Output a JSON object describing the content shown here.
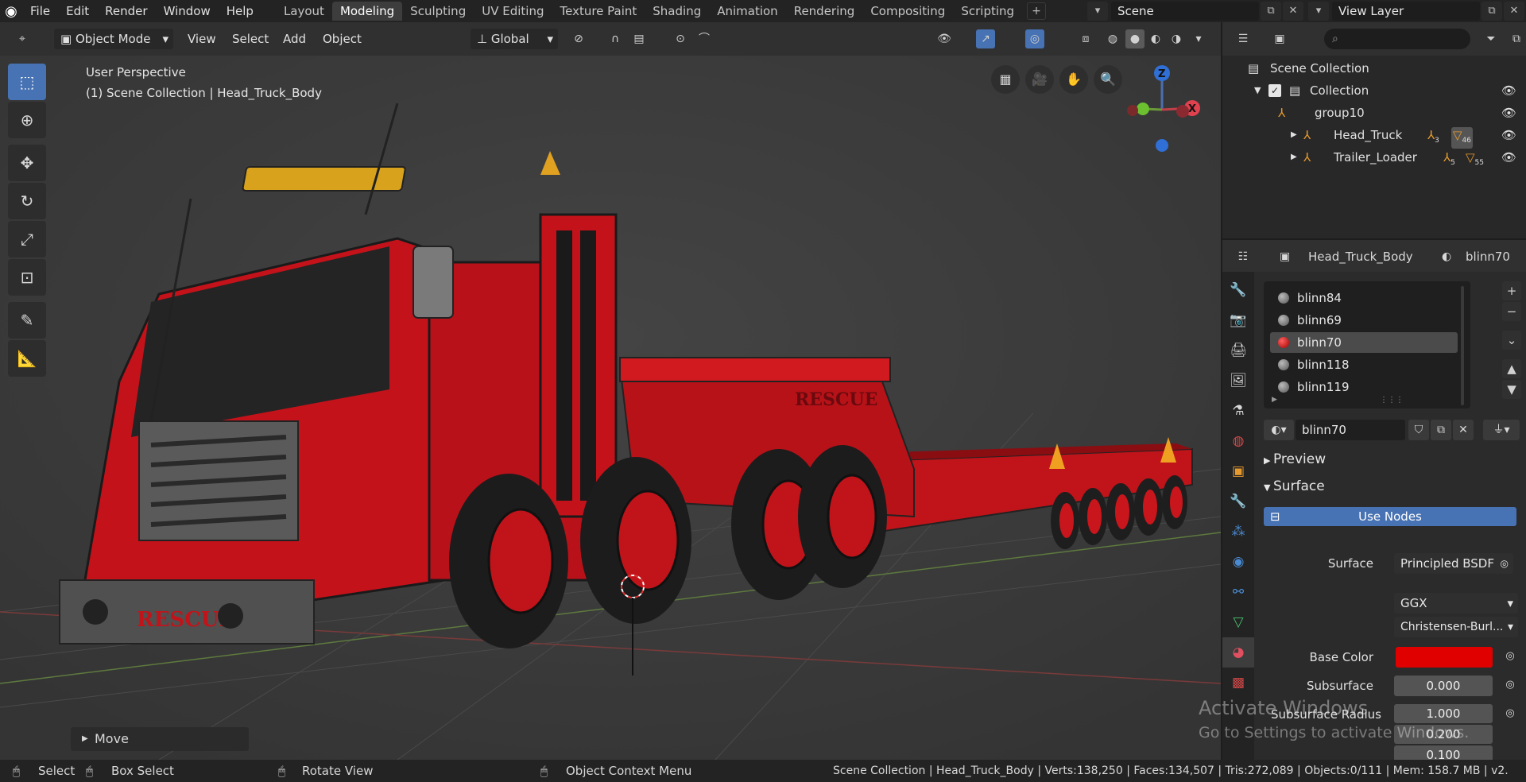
{
  "menu": [
    "File",
    "Edit",
    "Render",
    "Window",
    "Help"
  ],
  "workspaces": [
    "Layout",
    "Modeling",
    "Sculpting",
    "UV Editing",
    "Texture Paint",
    "Shading",
    "Animation",
    "Rendering",
    "Compositing",
    "Scripting"
  ],
  "active_workspace": "Modeling",
  "scene_name": "Scene",
  "view_layer": "View Layer",
  "viewport_header": {
    "mode": "Object Mode",
    "menus": [
      "View",
      "Select",
      "Add",
      "Object"
    ],
    "orientation": "Global"
  },
  "viewport": {
    "perspective_label": "User Perspective",
    "context_label": "(1) Scene Collection | Head_Truck_Body",
    "gizmo_axes": [
      "Z",
      "X"
    ],
    "operator_panel": "Move",
    "vehicle_text_front": "RESCUE",
    "vehicle_text_side": "RESCUE"
  },
  "outliner": {
    "rows": [
      {
        "label": "Scene Collection"
      },
      {
        "label": "Collection"
      },
      {
        "label": "group10"
      },
      {
        "label": "Head_Truck",
        "badge_a": "3",
        "badge_b": "46"
      },
      {
        "label": "Trailer_Loader",
        "badge_a": "5",
        "badge_b": "55"
      }
    ]
  },
  "properties": {
    "object_name": "Head_Truck_Body",
    "material_name": "blinn70",
    "slots": [
      "blinn84",
      "blinn69",
      "blinn70",
      "blinn118",
      "blinn119"
    ],
    "active_slot": "blinn70",
    "material_field": "blinn70",
    "panels": {
      "preview": "Preview",
      "surface": "Surface"
    },
    "use_nodes": "Use Nodes",
    "surface_label": "Surface",
    "surface_value": "Principled BSDF",
    "distribution": "GGX",
    "subsurface_method": "Christensen-Burl...",
    "base_color_label": "Base Color",
    "base_color": "#e00000",
    "subsurface_label": "Subsurface",
    "subsurface_value": "0.000",
    "subsurface_radius_label": "Subsurface Radius",
    "radius_values": [
      "1.000",
      "0.200",
      "0.100"
    ]
  },
  "watermark": {
    "line1": "Activate Windows",
    "line2": "Go to Settings to activate Windows."
  },
  "statusbar": {
    "select": "Select",
    "box_select": "Box Select",
    "rotate_view": "Rotate View",
    "context_menu": "Object Context Menu",
    "stats": "Scene Collection | Head_Truck_Body | Verts:138,250 | Faces:134,507 | Tris:272,089 | Objects:0/111 | Mem: 158.7 MB | v2."
  }
}
